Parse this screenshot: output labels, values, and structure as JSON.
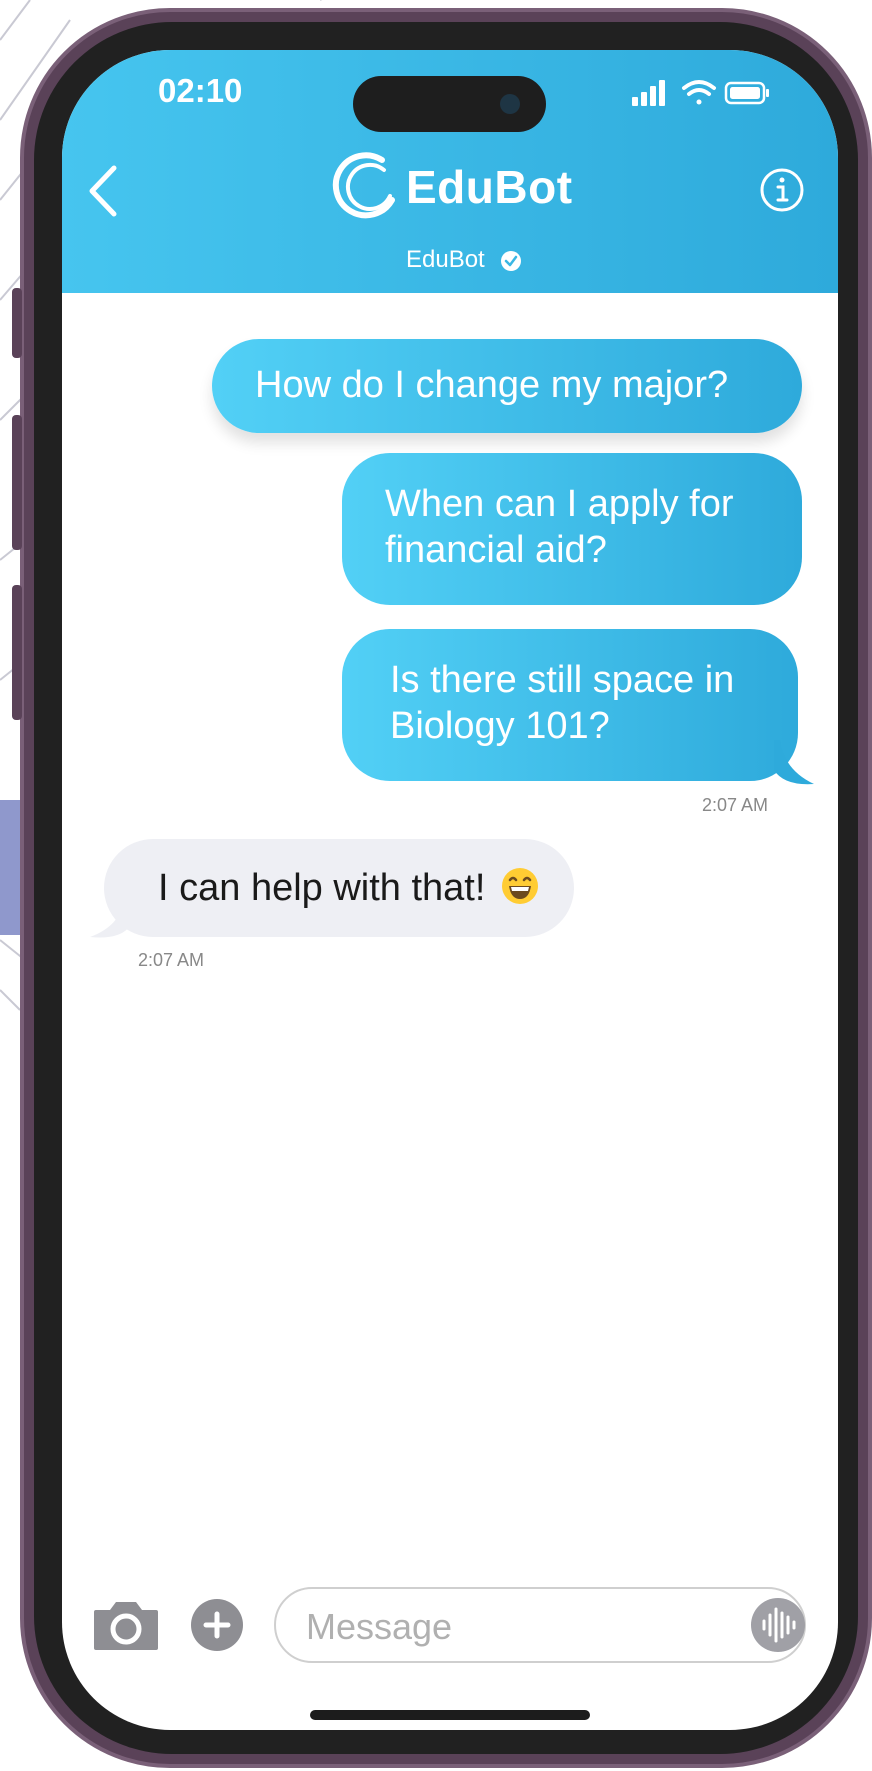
{
  "status_bar": {
    "time": "02:10",
    "icons": [
      "signal-icon",
      "wifi-icon",
      "battery-icon"
    ]
  },
  "header": {
    "back_icon": "chevron-left-icon",
    "logo_text": "EduBot",
    "info_icon": "info-icon",
    "contact_name": "EduBot",
    "verified_icon": "verified-badge-icon",
    "colors": {
      "gradient_start": "#46c5ef",
      "gradient_end": "#2eaadb"
    }
  },
  "messages": {
    "outgoing": [
      {
        "text": "How do I change my major?"
      },
      {
        "text": "When can I apply for financial aid?"
      },
      {
        "text": "Is there still space in Biology 101?"
      }
    ],
    "outgoing_time": "2:07 AM",
    "incoming": [
      {
        "text": "I can help with that!",
        "emoji": "grinning-face-icon"
      }
    ],
    "incoming_time": "2:07 AM"
  },
  "composer": {
    "camera_icon": "camera-icon",
    "plus_icon": "plus-icon",
    "placeholder": "Message",
    "audio_icon": "audio-waveform-icon"
  }
}
